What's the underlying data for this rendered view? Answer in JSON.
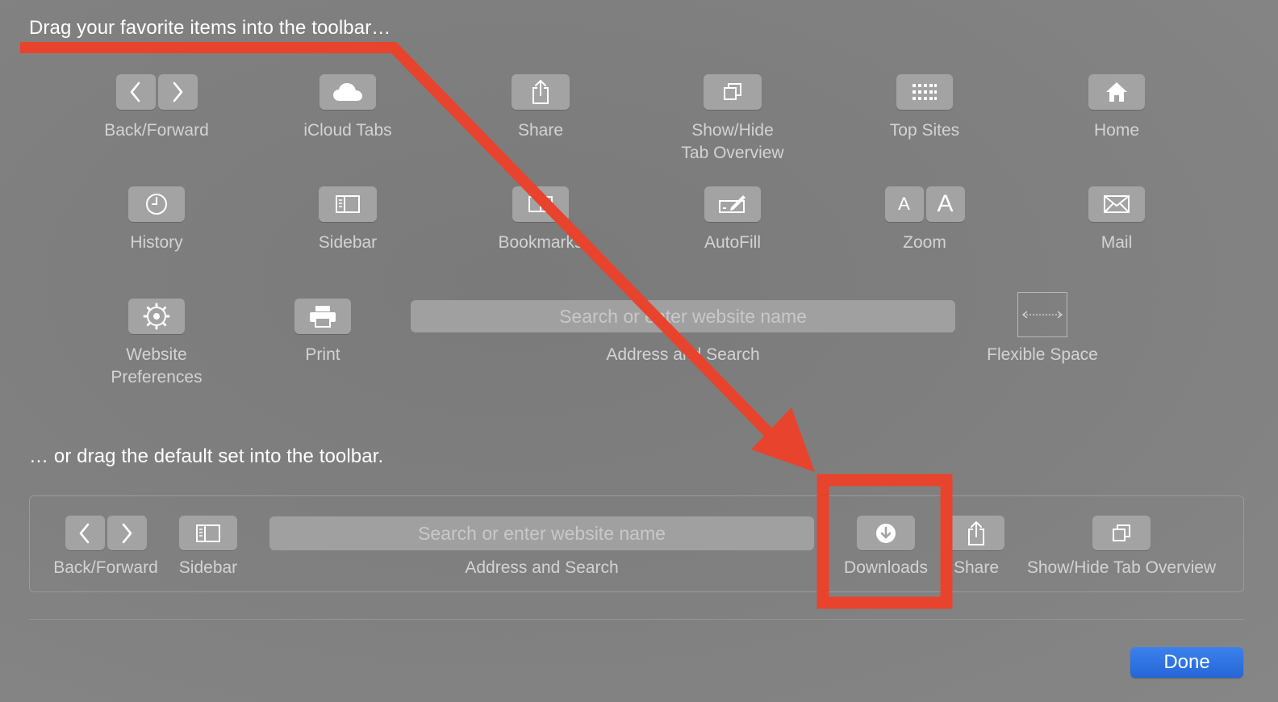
{
  "headings": {
    "favorites": "Drag your favorite items into the toolbar…",
    "default_set": "… or drag the default set into the toolbar."
  },
  "palette": [
    {
      "id": "back-forward",
      "label": "Back/Forward",
      "icons": [
        "chevron-left-icon",
        "chevron-right-icon"
      ]
    },
    {
      "id": "icloud-tabs",
      "label": "iCloud Tabs",
      "icons": [
        "cloud-icon"
      ]
    },
    {
      "id": "share",
      "label": "Share",
      "icons": [
        "share-icon"
      ]
    },
    {
      "id": "tab-overview",
      "label": "Show/Hide\nTab Overview",
      "icons": [
        "tab-overview-icon"
      ]
    },
    {
      "id": "top-sites",
      "label": "Top Sites",
      "icons": [
        "grid-icon"
      ]
    },
    {
      "id": "home",
      "label": "Home",
      "icons": [
        "home-icon"
      ]
    },
    {
      "id": "history",
      "label": "History",
      "icons": [
        "clock-icon"
      ]
    },
    {
      "id": "sidebar",
      "label": "Sidebar",
      "icons": [
        "sidebar-icon"
      ]
    },
    {
      "id": "bookmarks",
      "label": "Bookmarks",
      "icons": [
        "bookmarks-icon"
      ]
    },
    {
      "id": "autofill",
      "label": "AutoFill",
      "icons": [
        "pencil-icon"
      ]
    },
    {
      "id": "zoom",
      "label": "Zoom",
      "icons": [
        "zoom-out-icon",
        "zoom-in-icon"
      ]
    },
    {
      "id": "mail",
      "label": "Mail",
      "icons": [
        "envelope-icon"
      ]
    },
    {
      "id": "website-preferences",
      "label": "Website\nPreferences",
      "icons": [
        "gear-icon"
      ]
    },
    {
      "id": "print",
      "label": "Print",
      "icons": [
        "printer-icon"
      ]
    },
    {
      "id": "address-search",
      "label": "Address and Search",
      "placeholder": "Search or enter website name"
    },
    {
      "id": "flexible-space",
      "label": "Flexible Space",
      "icons": [
        "flexible-space-icon"
      ]
    }
  ],
  "zoom_glyphs": {
    "small": "A",
    "large": "A"
  },
  "default_set": {
    "items": [
      {
        "id": "back-forward",
        "label": "Back/Forward"
      },
      {
        "id": "sidebar",
        "label": "Sidebar"
      },
      {
        "id": "address-search",
        "label": "Address and Search",
        "placeholder": "Search or enter website name"
      },
      {
        "id": "downloads",
        "label": "Downloads"
      },
      {
        "id": "share",
        "label": "Share"
      },
      {
        "id": "tab-overview",
        "label": "Show/Hide Tab Overview"
      }
    ]
  },
  "buttons": {
    "done": "Done"
  },
  "annotation": {
    "color": "#e8432d"
  },
  "colors": {
    "background": "#808080",
    "button_fill": "#a3a3a3",
    "label_text": "#d3d3d3",
    "done_button": "#2e74e4"
  }
}
